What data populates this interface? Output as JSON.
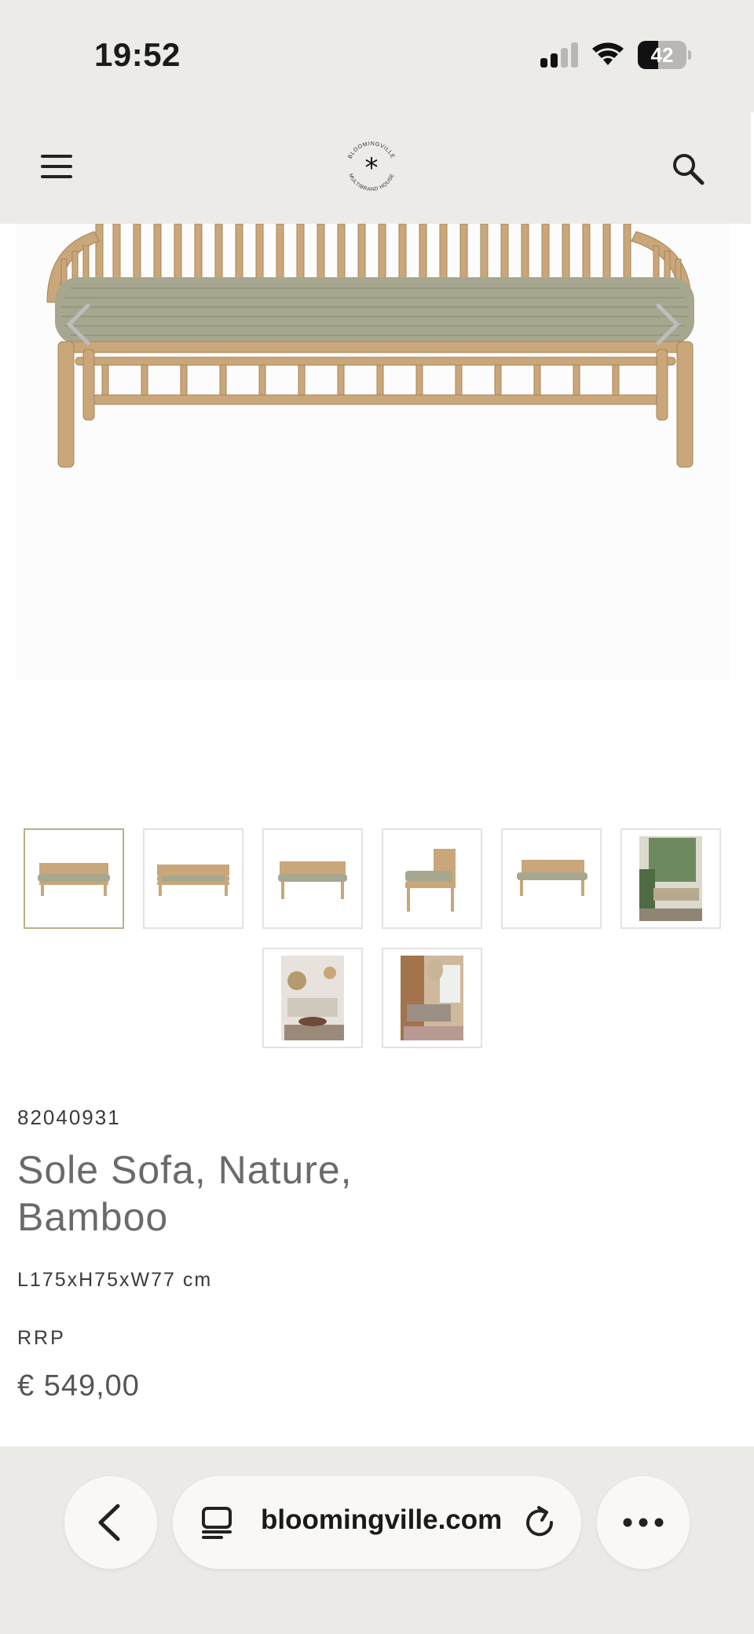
{
  "status_bar": {
    "time": "19:52",
    "battery_level": "42",
    "signal_bars_active": 2
  },
  "header": {
    "logo_text_top": "BLOOMINGVILLE",
    "logo_text_bottom": "MULTIBRAND HOUSE",
    "logo_mark": "*",
    "menu_icon": "hamburger-menu-icon",
    "search_icon": "search-icon"
  },
  "gallery": {
    "thumbnail_count": 8,
    "active_index": 0,
    "prev_icon": "chevron-left-icon",
    "next_icon": "chevron-right-icon"
  },
  "product": {
    "sku": "82040931",
    "title_line1": "Sole Sofa, Nature,",
    "title_line2": "Bamboo",
    "dimensions": "L175xH75xW77 cm",
    "rrp_label": "RRP",
    "price": "€ 549,00"
  },
  "browser": {
    "url": "bloomingville.com",
    "back_icon": "back-chevron-icon",
    "tabs_icon": "tab-overview-icon",
    "reload_icon": "reload-icon",
    "more_icon": "more-dots-icon"
  },
  "colors": {
    "header_bg": "#edebe8",
    "browser_bar_bg": "#eceae6",
    "bamboo": "#c9a77a",
    "cushion": "#a7a790",
    "active_thumb_border": "#b8b08e"
  }
}
